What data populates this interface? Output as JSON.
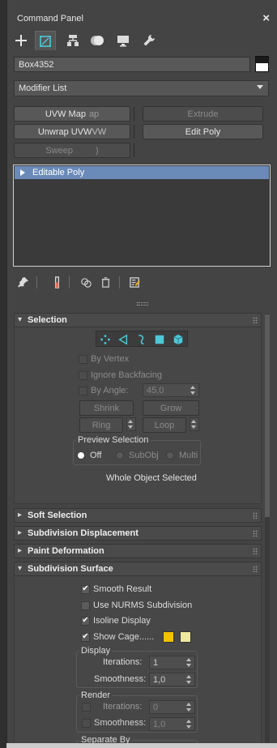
{
  "titlebar": {
    "title": "Command Panel",
    "close": "×"
  },
  "tabs": [
    {
      "name": "create",
      "icon": "plus-icon"
    },
    {
      "name": "modify",
      "icon": "modify-icon",
      "active": true
    },
    {
      "name": "hierarchy",
      "icon": "hierarchy-icon"
    },
    {
      "name": "motion",
      "icon": "motion-icon"
    },
    {
      "name": "display",
      "icon": "display-icon"
    },
    {
      "name": "utilities",
      "icon": "wrench-icon"
    }
  ],
  "object": {
    "name": "Box4352",
    "color_top": "#1a1a1a",
    "color_bottom": "#ffffff"
  },
  "modifier_list": {
    "label": "Modifier List"
  },
  "modifier_buttons": {
    "uvw_map": "UVW Map",
    "uvw_map_trail": "ap",
    "extrude": "Extrude",
    "unwrap": "Unwrap UVW",
    "unwrap_trail": "VW",
    "edit_poly": "Edit Poly",
    "sweep": "Sweep",
    "sweep_trail": ")"
  },
  "stack": {
    "items": [
      {
        "label": "Editable Poly",
        "selected": true
      }
    ]
  },
  "stack_tools": [
    "pin-stack-icon",
    "show-end-result-icon",
    "make-unique-icon",
    "remove-modifier-icon",
    "configure-sets-icon"
  ],
  "rollouts": {
    "selection": {
      "title": "Selection",
      "subobject_icons": [
        "vertex-icon",
        "edge-icon",
        "border-icon",
        "polygon-icon",
        "element-icon"
      ],
      "by_vertex": "By Vertex",
      "ignore_backfacing": "Ignore Backfacing",
      "by_angle": "By Angle:",
      "angle_value": "45,0",
      "shrink": "Shrink",
      "grow": "Grow",
      "ring": "Ring",
      "loop": "Loop",
      "preview_group": "Preview Selection",
      "preview_off": "Off",
      "preview_subobj": "SubObj",
      "preview_multi": "Multi",
      "status": "Whole Object Selected"
    },
    "soft_selection": {
      "title": "Soft Selection"
    },
    "subdivision_displacement": {
      "title": "Subdivision Displacement"
    },
    "paint_deformation": {
      "title": "Paint Deformation"
    },
    "subdivision_surface": {
      "title": "Subdivision Surface",
      "smooth_result": "Smooth Result",
      "use_nurms": "Use NURMS Subdivision",
      "isoline_display": "Isoline Display",
      "show_cage": "Show Cage......",
      "cage_color_1": "#f2c200",
      "cage_color_2": "#eee8a0",
      "display_group": "Display",
      "display_iterations_label": "Iterations:",
      "display_iterations": "1",
      "display_smoothness_label": "Smoothness:",
      "display_smoothness": "1,0",
      "render_group": "Render",
      "render_iterations_label": "Iterations:",
      "render_iterations": "0",
      "render_smoothness_label": "Smoothness:",
      "render_smoothness": "1,0",
      "separate_by_group": "Separate By"
    }
  },
  "colors": {
    "selected_item": "#6a8ab8",
    "accent_icon": "#4fc8d8"
  }
}
